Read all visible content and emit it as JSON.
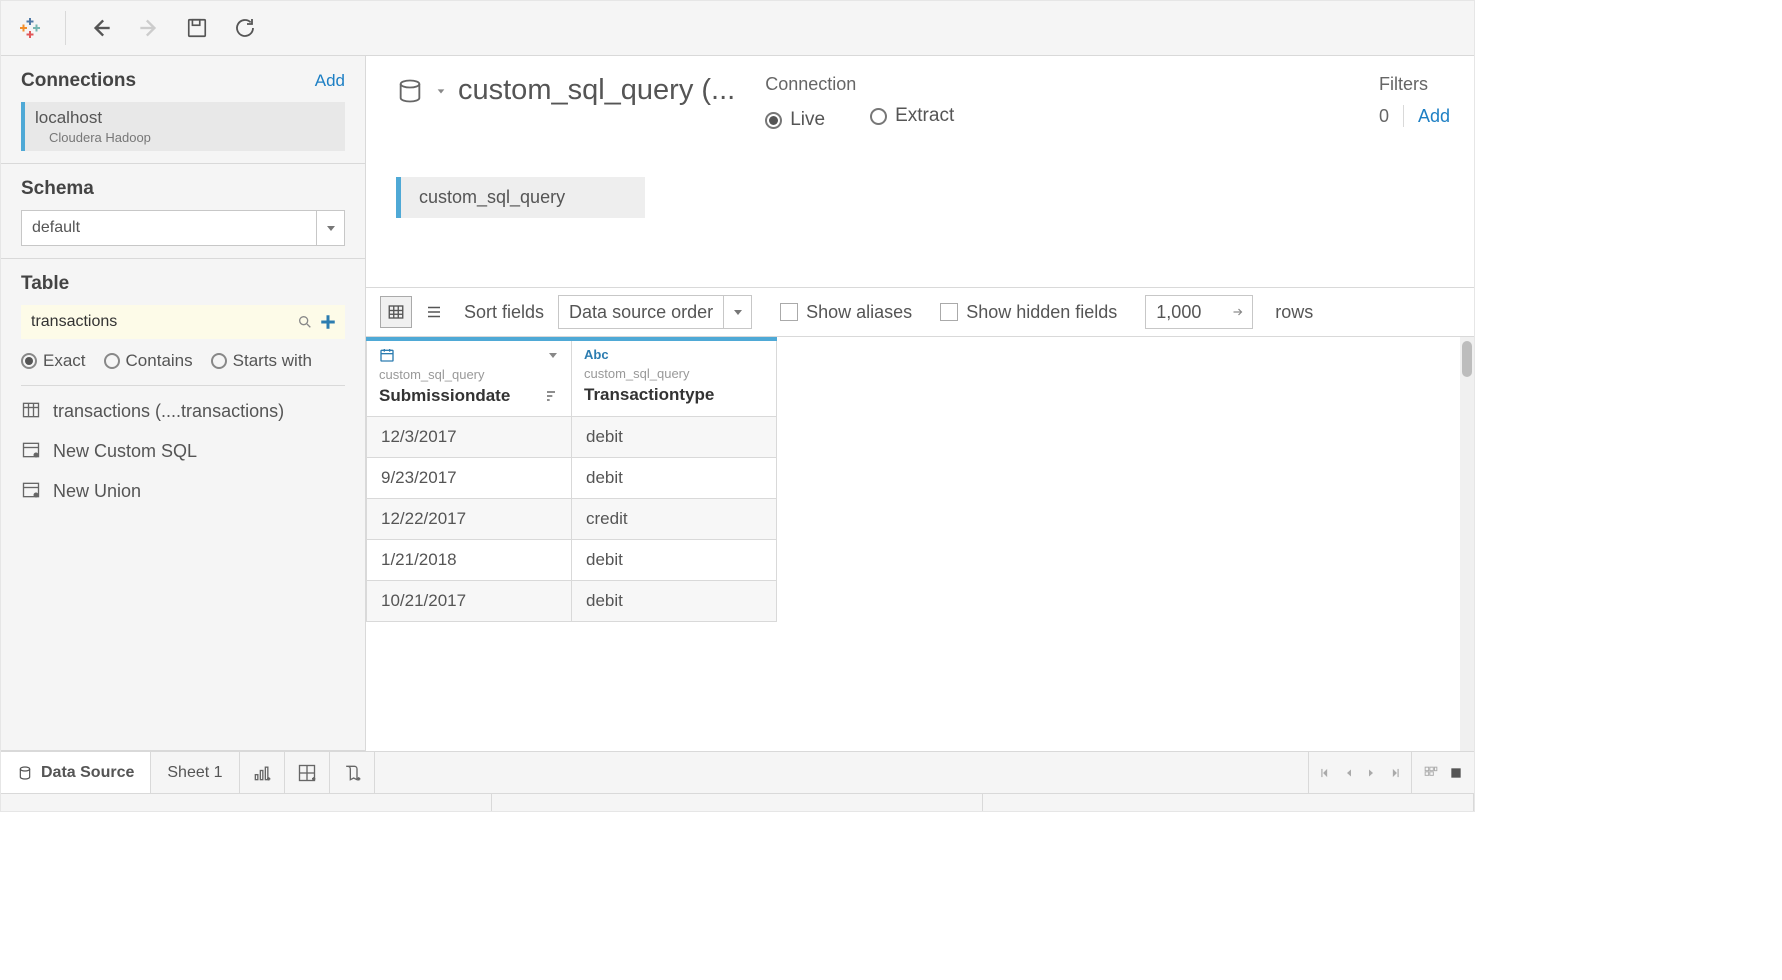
{
  "toolbar": {},
  "sidebar": {
    "connections_label": "Connections",
    "add_label": "Add",
    "connection": {
      "name": "localhost",
      "driver": "Cloudera Hadoop"
    },
    "schema_label": "Schema",
    "schema_value": "default",
    "table_label": "Table",
    "table_search_value": "transactions",
    "match_modes": {
      "exact": "Exact",
      "contains": "Contains",
      "starts_with": "Starts with"
    },
    "items": {
      "table_item": "transactions (....transactions)",
      "custom_sql": "New Custom SQL",
      "new_union": "New Union"
    }
  },
  "header": {
    "datasource_name": "custom_sql_query (...",
    "connection_label": "Connection",
    "live_label": "Live",
    "extract_label": "Extract",
    "filters_label": "Filters",
    "filters_count": "0",
    "filters_add": "Add"
  },
  "canvas": {
    "pill_label": "custom_sql_query"
  },
  "gridbar": {
    "sort_label": "Sort fields",
    "sort_value": "Data source order",
    "show_aliases": "Show aliases",
    "show_hidden": "Show hidden fields",
    "rows_value": "1,000",
    "rows_label": "rows"
  },
  "grid": {
    "columns": [
      {
        "type_label": "date",
        "source": "custom_sql_query",
        "name": "Submissiondate"
      },
      {
        "type_label": "Abc",
        "source": "custom_sql_query",
        "name": "Transactiontype"
      }
    ],
    "rows": [
      {
        "c0": "12/3/2017",
        "c1": "debit"
      },
      {
        "c0": "9/23/2017",
        "c1": "debit"
      },
      {
        "c0": "12/22/2017",
        "c1": "credit"
      },
      {
        "c0": "1/21/2018",
        "c1": "debit"
      },
      {
        "c0": "10/21/2017",
        "c1": "debit"
      }
    ]
  },
  "bottom": {
    "data_source": "Data Source",
    "sheet1": "Sheet 1"
  }
}
